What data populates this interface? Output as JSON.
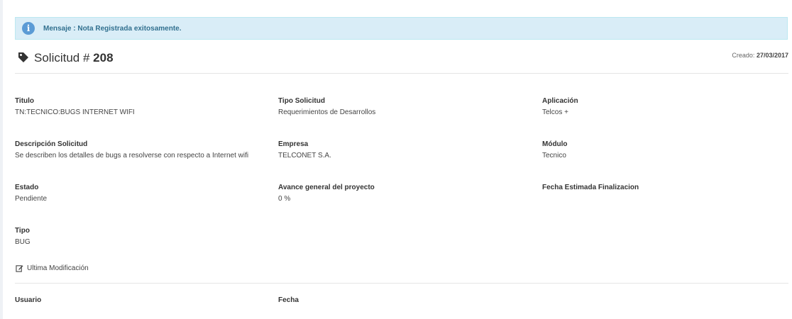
{
  "alert": {
    "icon": "info-icon",
    "message": "Mensaje : Nota Registrada exitosamente."
  },
  "header": {
    "title_prefix": "Solicitud #",
    "number": "208",
    "created_label": "Creado:",
    "created_date": "27/03/2017",
    "icon": "tag-icon"
  },
  "fields": {
    "titulo": {
      "label": "Titulo",
      "value": "TN:TECNICO:BUGS INTERNET WIFI"
    },
    "tipo_solicitud": {
      "label": "Tipo Solicitud",
      "value": "Requerimientos de Desarrollos"
    },
    "aplicacion": {
      "label": "Aplicación",
      "value": "Telcos +"
    },
    "descripcion": {
      "label": "Descripción Solicitud",
      "value": "Se describen los detalles de bugs a resolverse con respecto a Internet wifi"
    },
    "empresa": {
      "label": "Empresa",
      "value": "TELCONET S.A."
    },
    "modulo": {
      "label": "Módulo",
      "value": "Tecnico"
    },
    "estado": {
      "label": "Estado",
      "value": "Pendiente"
    },
    "avance": {
      "label": "Avance general del proyecto",
      "value": "0 %"
    },
    "fecha_estimada": {
      "label": "Fecha Estimada Finalizacion",
      "value": ""
    },
    "tipo": {
      "label": "Tipo",
      "value": "BUG"
    }
  },
  "last_modification": {
    "icon": "edit-icon",
    "label": "Ultima Modificación"
  },
  "history": {
    "usuario_label": "Usuario",
    "fecha_label": "Fecha"
  }
}
